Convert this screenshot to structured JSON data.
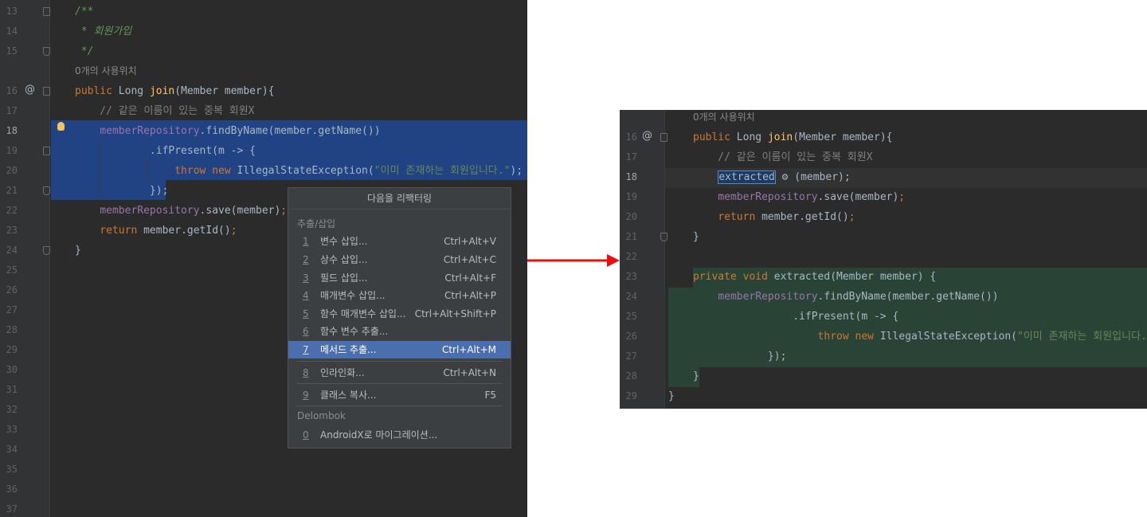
{
  "left_editor": {
    "lines": [
      {
        "num": "13",
        "kind": "doc",
        "text": "/**"
      },
      {
        "num": "14",
        "kind": "doc",
        "text": " * 회원가입"
      },
      {
        "num": "15",
        "kind": "doc",
        "text": " */"
      },
      {
        "num": "",
        "kind": "hint",
        "text": "0개의 사용위치"
      },
      {
        "num": "16",
        "kind": "join",
        "text": ""
      },
      {
        "num": "17",
        "kind": "comment",
        "text": "    // 같은 이름이 있는 중복 회원X"
      },
      {
        "num": "18",
        "kind": "find",
        "text": ""
      },
      {
        "num": "19",
        "kind": "plain",
        "text": "            .ifPresent(m -> {"
      },
      {
        "num": "20",
        "kind": "throw",
        "text": ""
      },
      {
        "num": "21",
        "kind": "plain",
        "text": "            });"
      },
      {
        "num": "22",
        "kind": "save",
        "text": ""
      },
      {
        "num": "23",
        "kind": "return",
        "text": ""
      },
      {
        "num": "24",
        "kind": "plain",
        "text": "}"
      },
      {
        "num": "25",
        "kind": "plain",
        "text": ""
      },
      {
        "num": "26",
        "kind": "plain",
        "text": ""
      },
      {
        "num": "27",
        "kind": "plain",
        "text": ""
      },
      {
        "num": "28",
        "kind": "plain",
        "text": ""
      },
      {
        "num": "29",
        "kind": "plain",
        "text": ""
      },
      {
        "num": "30",
        "kind": "plain",
        "text": ""
      },
      {
        "num": "31",
        "kind": "plain",
        "text": ""
      },
      {
        "num": "32",
        "kind": "plain",
        "text": ""
      },
      {
        "num": "33",
        "kind": "plain",
        "text": ""
      },
      {
        "num": "34",
        "kind": "plain",
        "text": ""
      },
      {
        "num": "35",
        "kind": "plain",
        "text": ""
      },
      {
        "num": "36",
        "kind": "plain",
        "text": ""
      },
      {
        "num": "37",
        "kind": "plain",
        "text": ""
      }
    ],
    "current_line": "18"
  },
  "code_tokens": {
    "kw_public": "public",
    "kw_return": "return",
    "kw_throw": "throw",
    "kw_new": "new",
    "kw_private": "private",
    "kw_void": "void",
    "type_long": "Long ",
    "fn_join": "join",
    "join_params": "(Member member){",
    "field_repo": "memberRepository",
    "find_call": ".findByName(member.getName())",
    "exception_class": " IllegalStateException(",
    "exception_msg": "\"이미 존재하는 회원입니다.\"",
    "exception_tail": ");",
    "save_call": ".save(member)",
    "semicolon": ";",
    "return_expr": " member.getId()",
    "extracted_name": "extracted",
    "extracted_args": " (member);",
    "method_sig": " extracted(Member member) {",
    "at_marker": "@"
  },
  "refactor_popup": {
    "title": "다음을 리팩터링",
    "section_extract": "추출/삽입",
    "items": [
      {
        "num": "1",
        "label": "변수 삽입...",
        "shortcut": "Ctrl+Alt+V",
        "active": false
      },
      {
        "num": "2",
        "label": "상수 삽입...",
        "shortcut": "Ctrl+Alt+C",
        "active": false
      },
      {
        "num": "3",
        "label": "필드 삽입...",
        "shortcut": "Ctrl+Alt+F",
        "active": false
      },
      {
        "num": "4",
        "label": "매개변수 삽입...",
        "shortcut": "Ctrl+Alt+P",
        "active": false
      },
      {
        "num": "5",
        "label": "함수 매개변수 삽입...",
        "shortcut": "Ctrl+Alt+Shift+P",
        "active": false
      },
      {
        "num": "6",
        "label": "함수 변수 추출...",
        "shortcut": "",
        "active": false
      },
      {
        "num": "7",
        "label": "메서드 추출...",
        "shortcut": "Ctrl+Alt+M",
        "active": true
      }
    ],
    "inline_item": {
      "num": "8",
      "label": "인라인화...",
      "shortcut": "Ctrl+Alt+N"
    },
    "copy_item": {
      "num": "9",
      "label": "클래스 복사...",
      "shortcut": "F5"
    },
    "section_delombok": "Delombok",
    "androidx_item": {
      "num": "0",
      "label": "AndroidX로 마이그레이션..."
    }
  },
  "right_editor": {
    "hint": "0개의 사용위치",
    "line_numbers": [
      "16",
      "17",
      "18",
      "19",
      "20",
      "21",
      "22",
      "23",
      "24",
      "25",
      "26",
      "27",
      "28",
      "29"
    ],
    "comment": "    // 같은 이름이 있는 중복 회원X",
    "if_present": "                .ifPresent(m -> {",
    "close_lambda": "            });",
    "close_brace_inner": "}",
    "close_brace_outer": "}",
    "current_line": "18"
  },
  "arrow_color": "#e8100f"
}
